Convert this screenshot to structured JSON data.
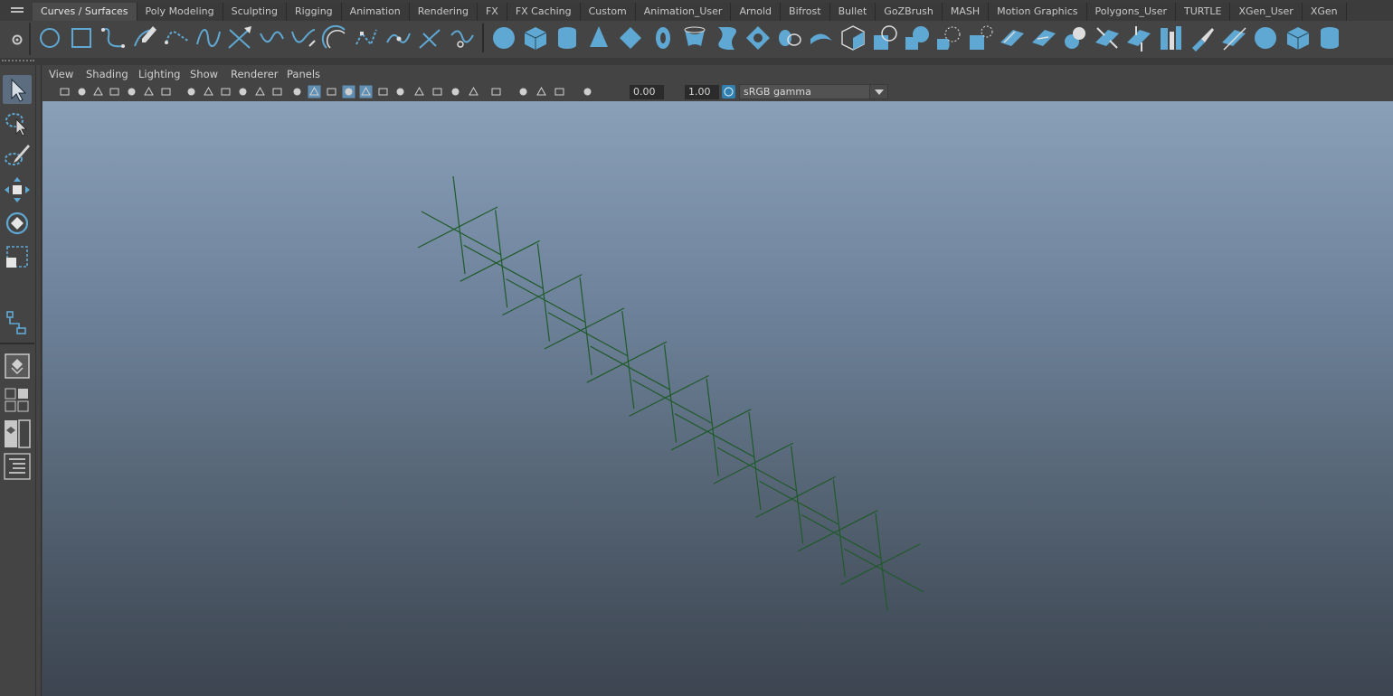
{
  "shelf": {
    "tabs": [
      {
        "label": "Curves / Surfaces",
        "active": true
      },
      {
        "label": "Poly Modeling",
        "active": false
      },
      {
        "label": "Sculpting",
        "active": false
      },
      {
        "label": "Rigging",
        "active": false
      },
      {
        "label": "Animation",
        "active": false
      },
      {
        "label": "Rendering",
        "active": false
      },
      {
        "label": "FX",
        "active": false
      },
      {
        "label": "FX Caching",
        "active": false
      },
      {
        "label": "Custom",
        "active": false
      },
      {
        "label": "Animation_User",
        "active": false
      },
      {
        "label": "Arnold",
        "active": false
      },
      {
        "label": "Bifrost",
        "active": false
      },
      {
        "label": "Bullet",
        "active": false
      },
      {
        "label": "GoZBrush",
        "active": false
      },
      {
        "label": "MASH",
        "active": false
      },
      {
        "label": "Motion Graphics",
        "active": false
      },
      {
        "label": "Polygons_User",
        "active": false
      },
      {
        "label": "TURTLE",
        "active": false
      },
      {
        "label": "XGen_User",
        "active": false
      },
      {
        "label": "XGen",
        "active": false
      }
    ],
    "accent_color": "#5fa8d3",
    "curve_tools": [
      "nurbs-circle-icon",
      "nurbs-square-icon",
      "cv-curve-icon",
      "pencil-curve-icon",
      "ep-curve-icon",
      "bezier-curve-icon",
      "curve-tool-icon",
      "arc-icon",
      "arc-tool-icon",
      "bend-curve-icon",
      "curve-point-icon",
      "detach-curve-icon",
      "cut-curve-icon",
      "curve-offset-icon"
    ],
    "surface_tools": [
      "nurbs-sphere-icon",
      "nurbs-cube-icon",
      "nurbs-cylinder-icon",
      "nurbs-cone-icon",
      "nurbs-plane-icon",
      "nurbs-torus-icon",
      "revolve-icon",
      "loft-icon",
      "planar-icon",
      "extrude-icon",
      "birail-icon",
      "boundary-icon",
      "square-surface-icon",
      "bevel-icon",
      "bevel-plus-icon",
      "trim-icon",
      "intersect-icon",
      "project-curve-icon",
      "untrim-icon",
      "attach-surfaces-icon",
      "detach-surfaces-icon",
      "open-close-icon",
      "insert-isoparm-icon",
      "extend-icon",
      "rebuild-icon",
      "sculpt-geometry-icon",
      "surface-editing-icon"
    ]
  },
  "panel": {
    "menus": [
      "View",
      "Shading",
      "Lighting",
      "Show",
      "Renderer",
      "Panels"
    ],
    "exposure": "0.00",
    "gamma": "1.00",
    "color_space": "sRGB gamma"
  },
  "viewport": {
    "object": "joint-chain",
    "joint_count": 11,
    "wire_color": "#1f5a2a"
  }
}
